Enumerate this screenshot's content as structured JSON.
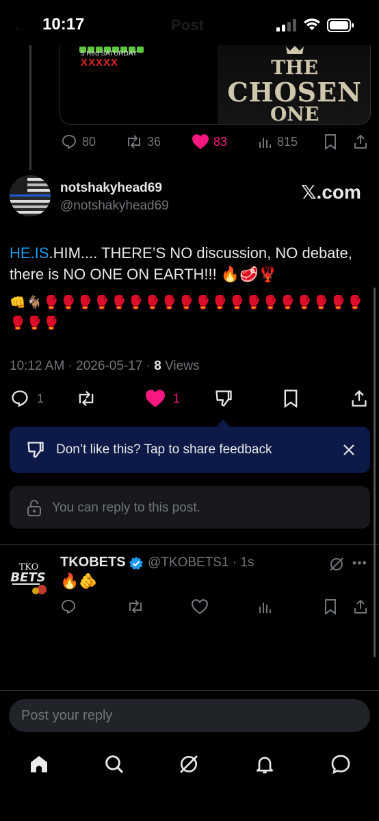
{
  "status_bar": {
    "time": "10:17"
  },
  "header": {
    "title": "Post"
  },
  "quoted_post": {
    "saturday_label": "5 Red SATURDAY",
    "red_marks": "XXXXX",
    "image_lines": [
      "THE",
      "CHOSEN",
      "ONE"
    ],
    "replies": "80",
    "reposts": "36",
    "likes": "83",
    "views": "815"
  },
  "main_post": {
    "display_name": "notshakyhead69",
    "handle": "@notshakyhead69",
    "source_badge": "𝕏.com",
    "link_text": "HE.IS",
    "text": ".HIM.... THERE’S NO discussion, NO debate, there is NO ONE ON EARTH!!! 🔥🥩🦞",
    "emoji_row": "👊🐐🥊🥊🥊🥊🥊🥊🥊🥊🥊🥊🥊🥊🥊🥊🥊🥊🥊🥊🥊🥊🥊🥊",
    "timestamp": "10:12 AM · 2026-05-17 · ",
    "views_count": "8",
    "views_label": " Views",
    "replies": "1",
    "likes": "1"
  },
  "feedback_banner": {
    "text": "Don’t like this? Tap to share feedback"
  },
  "reply_permission": {
    "text": "You can reply to this post."
  },
  "reply_tweet": {
    "avatar_top": "TKO",
    "avatar_main": "BETS",
    "display_name": "TKOBETS",
    "handle_time": "@TKOBETS1 · 1s",
    "text": "🔥🫵"
  },
  "composer": {
    "placeholder": "Post your reply"
  },
  "colors": {
    "accent": "#1d9bf0",
    "like": "#f91880",
    "banner": "#0d1a47"
  }
}
